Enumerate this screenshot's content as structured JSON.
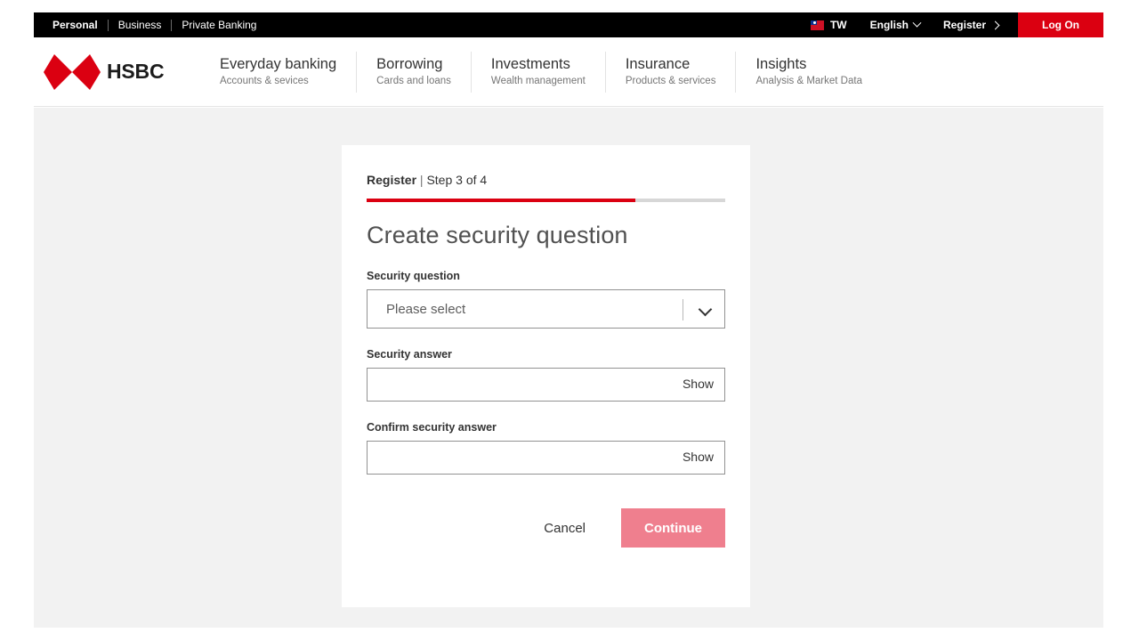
{
  "topbar": {
    "segments": [
      {
        "label": "Personal",
        "active": true
      },
      {
        "label": "Business",
        "active": false
      },
      {
        "label": "Private Banking",
        "active": false
      }
    ],
    "flag_icon": "taiwan-flag-icon",
    "region": "TW",
    "language": "English",
    "language_chevron_icon": "chevron-down-icon",
    "register": "Register",
    "register_chevron_icon": "chevron-right-icon",
    "logon": "Log On",
    "accent_red": "#db0011"
  },
  "header": {
    "brand": "HSBC",
    "logo_icon": "hsbc-hexagon-logo",
    "nav": [
      {
        "title": "Everyday banking",
        "sub": "Accounts & sevices"
      },
      {
        "title": "Borrowing",
        "sub": "Cards and loans"
      },
      {
        "title": "Investments",
        "sub": "Wealth management"
      },
      {
        "title": "Insurance",
        "sub": "Products & services"
      },
      {
        "title": "Insights",
        "sub": "Analysis & Market Data"
      }
    ]
  },
  "card": {
    "step_prefix": "Register",
    "step_separator": " | ",
    "step_text": "Step 3 of 4",
    "progress_percent": 75,
    "title": "Create security question",
    "security_question": {
      "label": "Security question",
      "selected": "Please select",
      "chevron_icon": "chevron-down-icon"
    },
    "security_answer": {
      "label": "Security answer",
      "value": "",
      "placeholder": "",
      "show_label": "Show"
    },
    "confirm_security_answer": {
      "label": "Confirm security answer",
      "value": "",
      "placeholder": "",
      "show_label": "Show"
    },
    "cancel_label": "Cancel",
    "continue_label": "Continue",
    "continue_color": "#ef7f8e"
  }
}
